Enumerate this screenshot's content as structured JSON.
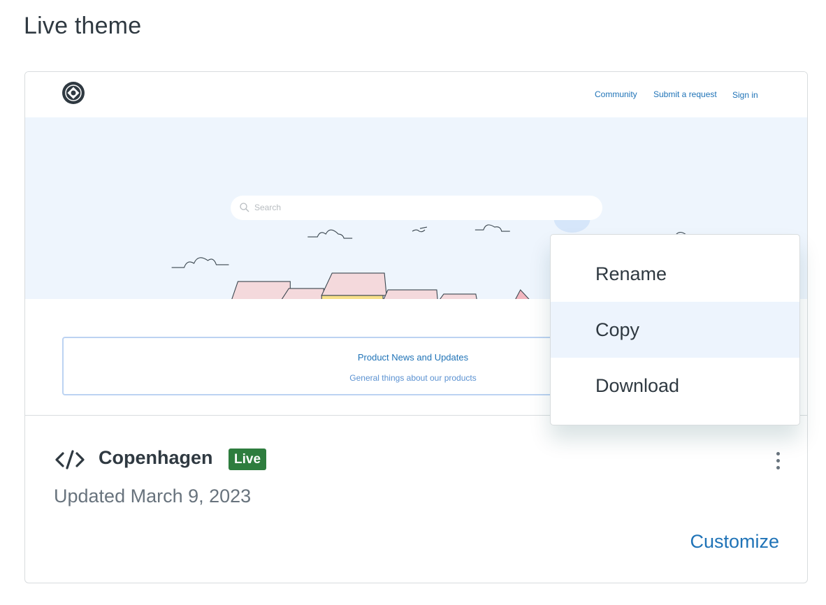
{
  "section_title": "Live theme",
  "preview": {
    "nav": [
      "Community",
      "Submit a request",
      "Sign in"
    ],
    "search_placeholder": "Search",
    "block_title": "Product News and Updates",
    "block_subtitle": "General things about our products"
  },
  "theme": {
    "name": "Copenhagen",
    "badge": "Live",
    "updated": "Updated March 9, 2023",
    "icon": "code-icon"
  },
  "actions": {
    "customize_label": "Customize",
    "more_icon": "kebab-icon"
  },
  "menu": {
    "items": [
      {
        "label": "Rename",
        "active": false
      },
      {
        "label": "Copy",
        "active": true
      },
      {
        "label": "Download",
        "active": false
      }
    ]
  },
  "colors": {
    "accent": "#1f73b7",
    "live_badge": "#2e7d3e",
    "hover": "#edf4fd"
  }
}
